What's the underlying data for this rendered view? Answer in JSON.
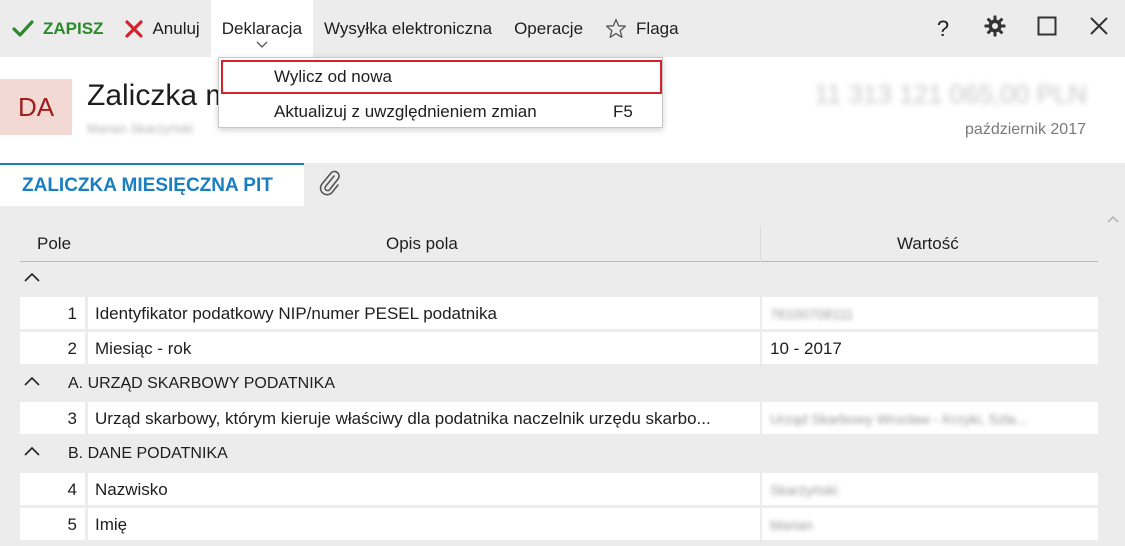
{
  "toolbar": {
    "save_label": "ZAPISZ",
    "cancel_label": "Anuluj",
    "declaration_label": "Deklaracja",
    "electronic_label": "Wysyłka elektroniczna",
    "operations_label": "Operacje",
    "flag_label": "Flaga",
    "help_label": "?"
  },
  "dropdown": {
    "items": [
      {
        "label": "Wylicz od nowa",
        "shortcut": ""
      },
      {
        "label": "Aktualizuj z uwzględnieniem zmian",
        "shortcut": "F5"
      }
    ]
  },
  "header": {
    "badge": "DA",
    "title": "Zaliczka m",
    "subtitle": "Marian Skarżyński",
    "amount": "11 313 121 065,00 PLN",
    "period": "październik 2017"
  },
  "tabs": {
    "active": "ZALICZKA MIESIĘCZNA PIT"
  },
  "table": {
    "headers": {
      "field": "Pole",
      "description": "Opis pola",
      "value": "Wartość"
    },
    "sections": [
      {
        "title": ""
      },
      {
        "title": "A. URZĄD SKARBOWY PODATNIKA"
      },
      {
        "title": "B. DANE PODATNIKA"
      }
    ],
    "rows": [
      {
        "num": "1",
        "desc": "Identyfikator podatkowy NIP/numer PESEL podatnika",
        "value": "76100708111"
      },
      {
        "num": "2",
        "desc": "Miesiąc - rok",
        "value": "10 - 2017"
      },
      {
        "num": "3",
        "desc": "Urząd skarbowy, którym kieruje właściwy dla podatnika naczelnik urzędu skarbo...",
        "value": "Urząd Skarbowy Wrocław - Krzyki, Szła..."
      },
      {
        "num": "4",
        "desc": "Nazwisko",
        "value": "Skarżyński"
      },
      {
        "num": "5",
        "desc": "Imię",
        "value": "Marian"
      }
    ]
  },
  "colors": {
    "save_green": "#2a8a2a",
    "cancel_red": "#d3242e",
    "accent_blue": "#1a7fc1",
    "badge_bg": "#f3d9d3",
    "badge_text": "#a01e1e"
  },
  "icons": {
    "save": "check-icon",
    "cancel": "x-icon",
    "flag": "star-icon",
    "help": "question-icon",
    "settings": "gear-icon",
    "maximize": "maximize-icon",
    "close": "close-icon",
    "attach": "paperclip-icon"
  }
}
